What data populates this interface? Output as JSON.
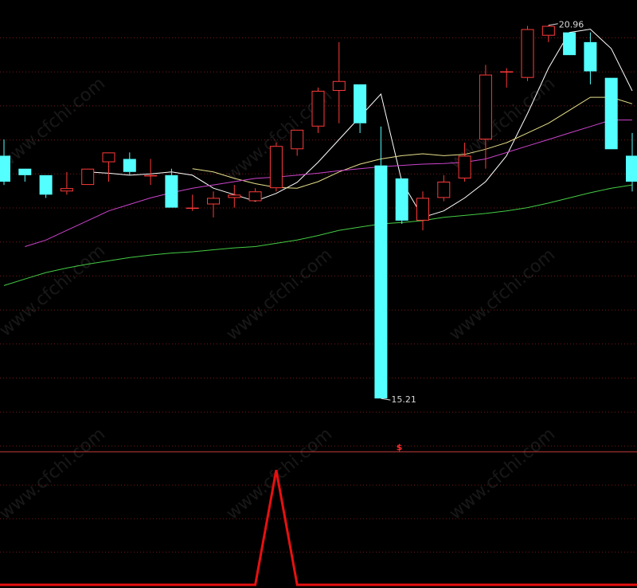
{
  "watermark": "www.cfchi.com",
  "chart_data": {
    "type": "candlestick",
    "ylim": [
      14.45,
      21.3
    ],
    "candles": [
      {
        "o": 18.95,
        "h": 19.2,
        "l": 18.5,
        "c": 18.55
      },
      {
        "o": 18.75,
        "h": 18.75,
        "l": 18.55,
        "c": 18.65
      },
      {
        "o": 18.65,
        "h": 18.65,
        "l": 18.3,
        "c": 18.35
      },
      {
        "o": 18.4,
        "h": 18.7,
        "l": 18.35,
        "c": 18.45
      },
      {
        "o": 18.5,
        "h": 18.75,
        "l": 18.5,
        "c": 18.75
      },
      {
        "o": 18.85,
        "h": 18.95,
        "l": 18.55,
        "c": 19.0
      },
      {
        "o": 18.9,
        "h": 19.0,
        "l": 18.65,
        "c": 18.7
      },
      {
        "o": 18.65,
        "h": 18.9,
        "l": 18.5,
        "c": 18.65
      },
      {
        "o": 18.65,
        "h": 18.75,
        "l": 18.15,
        "c": 18.15
      },
      {
        "o": 18.15,
        "h": 18.35,
        "l": 18.1,
        "c": 18.15
      },
      {
        "o": 18.2,
        "h": 18.4,
        "l": 18.0,
        "c": 18.3
      },
      {
        "o": 18.3,
        "h": 18.5,
        "l": 18.15,
        "c": 18.35
      },
      {
        "o": 18.25,
        "h": 18.45,
        "l": 18.25,
        "c": 18.4
      },
      {
        "o": 18.45,
        "h": 19.15,
        "l": 18.4,
        "c": 19.1
      },
      {
        "o": 19.05,
        "h": 19.35,
        "l": 18.95,
        "c": 19.35
      },
      {
        "o": 19.4,
        "h": 20.0,
        "l": 19.3,
        "c": 19.95
      },
      {
        "o": 19.95,
        "h": 20.7,
        "l": 19.45,
        "c": 20.1
      },
      {
        "o": 20.05,
        "h": 20.05,
        "l": 19.3,
        "c": 19.45
      },
      {
        "o": 18.8,
        "h": 19.4,
        "l": 15.21,
        "c": 15.21
      },
      {
        "o": 18.6,
        "h": 18.6,
        "l": 17.9,
        "c": 17.95
      },
      {
        "o": 17.95,
        "h": 18.4,
        "l": 17.8,
        "c": 18.3
      },
      {
        "o": 18.3,
        "h": 18.65,
        "l": 18.25,
        "c": 18.55
      },
      {
        "o": 18.6,
        "h": 19.15,
        "l": 18.55,
        "c": 18.95
      },
      {
        "o": 19.2,
        "h": 20.35,
        "l": 18.75,
        "c": 20.2
      },
      {
        "o": 20.25,
        "h": 20.3,
        "l": 20.0,
        "c": 20.25
      },
      {
        "o": 20.15,
        "h": 20.95,
        "l": 20.1,
        "c": 20.9
      },
      {
        "o": 20.8,
        "h": 20.96,
        "l": 20.7,
        "c": 20.95
      },
      {
        "o": 20.85,
        "h": 20.85,
        "l": 20.5,
        "c": 20.5
      },
      {
        "o": 20.7,
        "h": 20.85,
        "l": 20.05,
        "c": 20.25
      },
      {
        "o": 20.15,
        "h": 20.15,
        "l": 19.05,
        "c": 19.05
      },
      {
        "o": 18.95,
        "h": 19.3,
        "l": 18.4,
        "c": 18.55
      }
    ],
    "ma_series": [
      {
        "color": "#ffffff",
        "values": [
          null,
          null,
          null,
          null,
          18.7,
          18.68,
          18.65,
          18.67,
          18.7,
          18.65,
          18.45,
          18.35,
          18.25,
          18.37,
          18.54,
          18.85,
          19.2,
          19.55,
          19.9,
          18.55,
          18.0,
          18.1,
          18.3,
          18.55,
          18.95,
          19.6,
          20.3,
          20.85,
          20.9,
          20.6,
          19.95
        ]
      },
      {
        "color": "#e8e08a",
        "values": [
          null,
          null,
          null,
          null,
          null,
          null,
          null,
          null,
          null,
          18.75,
          18.7,
          18.6,
          18.52,
          18.46,
          18.45,
          18.55,
          18.7,
          18.82,
          18.9,
          18.95,
          18.98,
          18.95,
          18.97,
          19.05,
          19.15,
          19.3,
          19.45,
          19.65,
          19.85,
          19.85,
          19.75
        ]
      },
      {
        "color": "#cc44cc",
        "values": [
          null,
          17.55,
          17.65,
          17.8,
          17.95,
          18.1,
          18.2,
          18.3,
          18.38,
          18.45,
          18.5,
          18.55,
          18.6,
          18.62,
          18.65,
          18.68,
          18.72,
          18.75,
          18.78,
          18.8,
          18.82,
          18.83,
          18.85,
          18.9,
          19.0,
          19.1,
          19.2,
          19.3,
          19.4,
          19.5,
          19.5
        ]
      },
      {
        "color": "#44cc44",
        "values": [
          16.95,
          17.05,
          17.15,
          17.22,
          17.28,
          17.33,
          17.38,
          17.42,
          17.45,
          17.47,
          17.5,
          17.53,
          17.55,
          17.6,
          17.65,
          17.72,
          17.8,
          17.85,
          17.9,
          17.92,
          17.95,
          18.0,
          18.03,
          18.06,
          18.1,
          18.15,
          18.22,
          18.3,
          18.38,
          18.45,
          18.5
        ]
      }
    ],
    "annotations": {
      "high": "20.96",
      "low": "15.21"
    },
    "indicator": {
      "signal_label": "$",
      "ylim": [
        0,
        1
      ],
      "values": [
        0,
        0,
        0,
        0,
        0,
        0,
        0,
        0,
        0,
        0,
        0,
        0,
        0,
        1,
        0,
        0,
        0,
        0,
        0,
        0,
        0,
        0,
        0,
        0,
        0,
        0,
        0,
        0,
        0,
        0,
        0
      ]
    }
  }
}
